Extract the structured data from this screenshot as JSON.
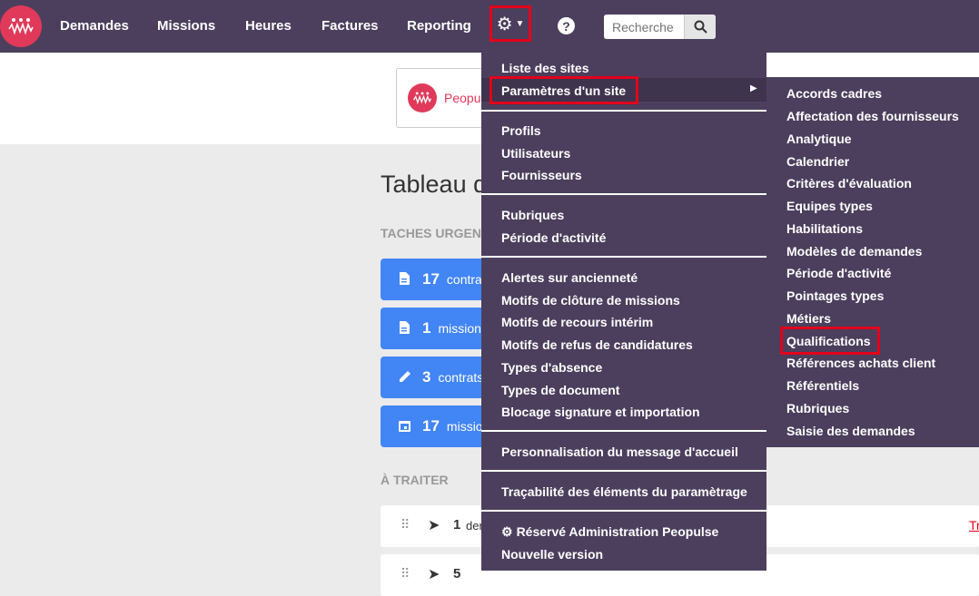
{
  "nav": {
    "items": [
      "Demandes",
      "Missions",
      "Heures",
      "Factures",
      "Reporting"
    ],
    "search_placeholder": "Recherche"
  },
  "site_card": {
    "name": "Peopuls"
  },
  "dashboard": {
    "title": "Tableau d",
    "urgent_label": "TACHES URGENT",
    "urgent_tasks": [
      {
        "icon": "document-icon",
        "count": "17",
        "text": "contrat"
      },
      {
        "icon": "document-icon",
        "count": "1",
        "text": "mission"
      },
      {
        "icon": "pencil-icon",
        "count": "3",
        "text": "contrats"
      },
      {
        "icon": "calendar-icon",
        "count": "17",
        "text": "missio"
      }
    ],
    "to_treat_label": "À TRAITER",
    "to_treat_rows": [
      {
        "count": "1",
        "text": "der",
        "link": "Tr"
      },
      {
        "count": "5",
        "text": "",
        "link": ""
      }
    ]
  },
  "settings_menu": {
    "groups": [
      [
        "Liste des sites",
        "Paramètres d'un site"
      ],
      [
        "Profils",
        "Utilisateurs",
        "Fournisseurs"
      ],
      [
        "Rubriques",
        "Période d'activité"
      ],
      [
        "Alertes sur ancienneté",
        "Motifs de clôture de missions",
        "Motifs de recours intérim",
        "Motifs de refus de candidatures",
        "Types d'absence",
        "Types de document",
        "Blocage signature et importation"
      ],
      [
        "Personnalisation du message d'accueil"
      ],
      [
        "Traçabilité des éléments du paramètrage"
      ],
      [
        "Réservé Administration Peopulse",
        "Nouvelle version"
      ]
    ]
  },
  "submenu": {
    "items": [
      "Accords cadres",
      "Affectation des fournisseurs",
      "Analytique",
      "Calendrier",
      "Critères d'évaluation",
      "Equipes types",
      "Habilitations",
      "Modèles de demandes",
      "Période d'activité",
      "Pointages types",
      "Métiers",
      "Qualifications",
      "Références achats client",
      "Référentiels",
      "Rubriques",
      "Saisie des demandes"
    ]
  },
  "colors": {
    "navbar": "#4b3f5d",
    "brand": "#e0395a",
    "highlight": "#e3001b",
    "task_blue": "#4285f4"
  }
}
